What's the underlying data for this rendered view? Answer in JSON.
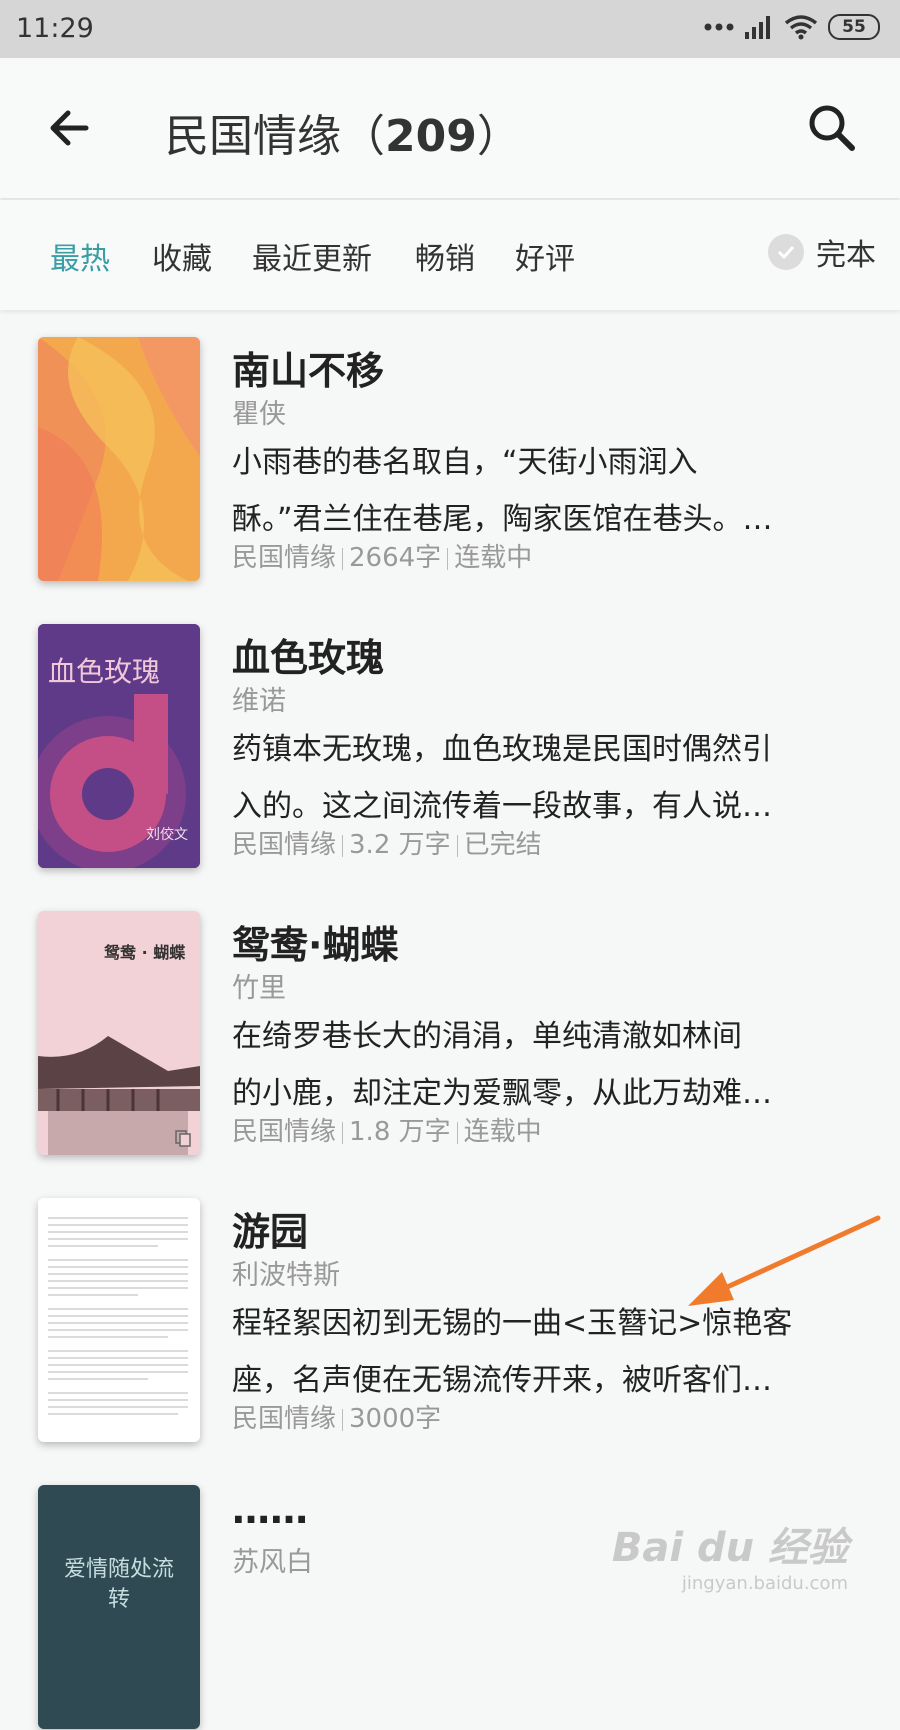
{
  "status_bar": {
    "time": "11:29",
    "battery": "55"
  },
  "header": {
    "title": "民国情缘（",
    "count": "209",
    "title_suffix": "）"
  },
  "filters": {
    "tabs": [
      "最热",
      "收藏",
      "最近更新",
      "畅销",
      "好评"
    ],
    "active_index": 0,
    "complete_label": "完本"
  },
  "books": [
    {
      "title": "南山不移",
      "author": "瞿侠",
      "desc": [
        "小雨巷的巷名取自，“天街小雨润入",
        "酥。”君兰住在巷尾，陶家医馆在巷头。…"
      ],
      "meta": [
        "民国情缘",
        "2664字",
        "连载中"
      ]
    },
    {
      "title": "血色玫瑰",
      "author": "维诺",
      "desc": [
        "药镇本无玫瑰，血色玫瑰是民国时偶然引",
        "入的。这之间流传着一段故事，有人说…"
      ],
      "meta": [
        "民国情缘",
        "3.2 万字",
        "已完结"
      ],
      "cover_title": "血色玫瑰",
      "cover_author": "刘佼文"
    },
    {
      "title": "鸳鸯·蝴蝶",
      "author": "竹里",
      "desc": [
        "在绮罗巷长大的涓涓，单纯清澈如林间",
        "的小鹿，却注定为爱飘零，从此万劫难…"
      ],
      "meta": [
        "民国情缘",
        "1.8 万字",
        "连载中"
      ],
      "cover_title": "鸳鸯 · 蝴蝶"
    },
    {
      "title": "游园",
      "author": "利波特斯",
      "desc": [
        "程轻絮因初到无锡的一曲<玉簪记>惊艳客",
        "座，名声便在无锡流传开来，被听客们…"
      ],
      "meta": [
        "民国情缘",
        "3000字"
      ]
    },
    {
      "title": "……",
      "author": "苏风白",
      "cover_title": "爱情随处流转"
    }
  ],
  "watermark": {
    "logo": "Bai du 经验",
    "url": "jingyan.baidu.com"
  },
  "colors": {
    "accent": "#3a9ea5",
    "annotation_arrow": "#f07b2c"
  }
}
